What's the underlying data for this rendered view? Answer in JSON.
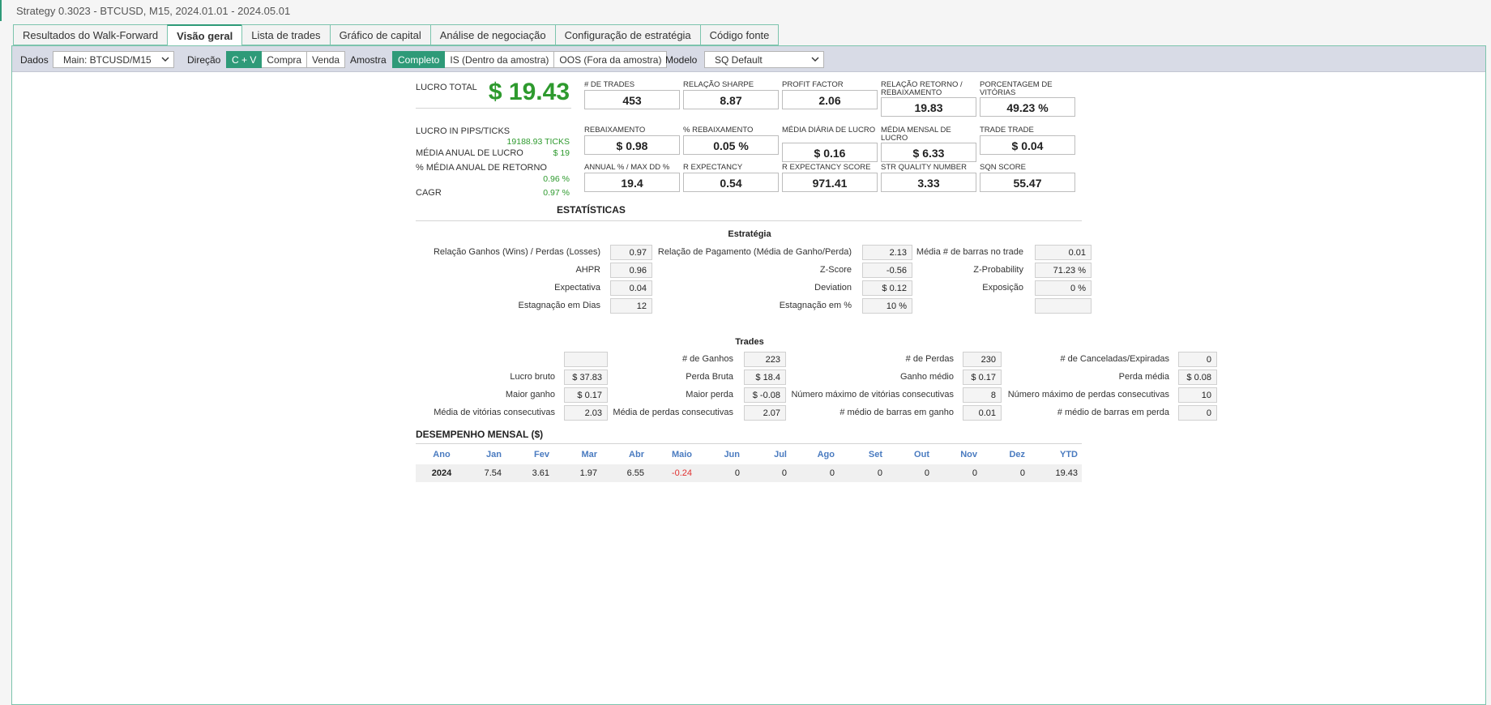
{
  "window": {
    "title": "Strategy 0.3023 - BTCUSD, M15, 2024.01.01 - 2024.05.01"
  },
  "tabs": [
    {
      "label": "Resultados do Walk-Forward"
    },
    {
      "label": "Visão geral"
    },
    {
      "label": "Lista de trades"
    },
    {
      "label": "Gráfico de capital"
    },
    {
      "label": "Análise de negociação"
    },
    {
      "label": "Configuração de estratégia"
    },
    {
      "label": "Código fonte"
    }
  ],
  "toolbar": {
    "dados_label": "Dados",
    "dados_value": "Main: BTCUSD/M15",
    "direcao_label": "Direção",
    "direcao_options": [
      "C + V",
      "Compra",
      "Venda"
    ],
    "amostra_label": "Amostra",
    "amostra_options": [
      "Completo",
      "IS (Dentro da amostra)",
      "OOS (Fora da amostra)"
    ],
    "modelo_label": "Modelo",
    "modelo_value": "SQ Default"
  },
  "summary": {
    "lucro_total_label": "LUCRO TOTAL",
    "lucro_total_value": "$ 19.43",
    "pips_label": "LUCRO IN PIPS/TICKS",
    "pips_value": "19188.93 TICKS",
    "media_anual_label": "MÉDIA ANUAL DE LUCRO",
    "media_anual_value": "$ 19",
    "pct_media_label": "% MÉDIA ANUAL DE RETORNO",
    "pct_media_value": "0.96 %",
    "cagr_label": "CAGR",
    "cagr_value": "0.97 %"
  },
  "metrics": [
    {
      "label": "# DE TRADES",
      "value": "453"
    },
    {
      "label": "RELAÇÃO SHARPE",
      "value": "8.87"
    },
    {
      "label": "PROFIT FACTOR",
      "value": "2.06"
    },
    {
      "label": "RELAÇÃO RETORNO / REBAIXAMENTO",
      "value": "19.83"
    },
    {
      "label": "PORCENTAGEM DE VITÓRIAS",
      "value": "49.23 %"
    },
    {
      "label": "REBAIXAMENTO",
      "value": "$ 0.98"
    },
    {
      "label": "% REBAIXAMENTO",
      "value": "0.05 %"
    },
    {
      "label": "MÉDIA DIÁRIA DE LUCRO",
      "value": "$ 0.16"
    },
    {
      "label": "MÉDIA MENSAL DE LUCRO",
      "value": "$ 6.33"
    },
    {
      "label": "TRADE TRADE",
      "value": "$ 0.04"
    },
    {
      "label": "ANNUAL % / MAX DD %",
      "value": "19.4"
    },
    {
      "label": "R EXPECTANCY",
      "value": "0.54"
    },
    {
      "label": "R EXPECTANCY SCORE",
      "value": "971.41"
    },
    {
      "label": "STR QUALITY NUMBER",
      "value": "3.33"
    },
    {
      "label": "SQN SCORE",
      "value": "55.47"
    }
  ],
  "estatisticas": {
    "title": "ESTATÍSTICAS",
    "estrategia_title": "Estratégia",
    "col1": [
      {
        "label": "Relação Ganhos (Wins) / Perdas (Losses)",
        "value": "0.97"
      },
      {
        "label": "AHPR",
        "value": "0.96"
      },
      {
        "label": "Expectativa",
        "value": "0.04"
      },
      {
        "label": "Estagnação em Dias",
        "value": "12"
      }
    ],
    "col2": [
      {
        "label": "Relação de Pagamento (Média de Ganho/Perda)",
        "value": "2.13"
      },
      {
        "label": "Z-Score",
        "value": "-0.56"
      },
      {
        "label": "Deviation",
        "value": "$ 0.12"
      },
      {
        "label": "Estagnação em %",
        "value": "10 %"
      }
    ],
    "col3": [
      {
        "label": "Média # de barras no trade",
        "value": "0.01"
      },
      {
        "label": "Z-Probability",
        "value": "71.23 %"
      },
      {
        "label": "Exposição",
        "value": "0 %"
      },
      {
        "label": "",
        "value": ""
      }
    ]
  },
  "trades": {
    "title": "Trades",
    "col1": [
      {
        "label": "",
        "value": ""
      },
      {
        "label": "Lucro bruto",
        "value": "$ 37.83"
      },
      {
        "label": "Maior ganho",
        "value": "$ 0.17"
      },
      {
        "label": "Média de vitórias consecutivas",
        "value": "2.03"
      }
    ],
    "col2": [
      {
        "label": "# de Ganhos",
        "value": "223"
      },
      {
        "label": "Perda Bruta",
        "value": "$ 18.4"
      },
      {
        "label": "Maior perda",
        "value": "$ -0.08"
      },
      {
        "label": "Média de perdas consecutivas",
        "value": "2.07"
      }
    ],
    "col3": [
      {
        "label": "# de Perdas",
        "value": "230"
      },
      {
        "label": "Ganho médio",
        "value": "$ 0.17"
      },
      {
        "label": "Número máximo de vitórias consecutivas",
        "value": "8"
      },
      {
        "label": "# médio de barras em ganho",
        "value": "0.01"
      }
    ],
    "col4": [
      {
        "label": "# de Canceladas/Expiradas",
        "value": "0"
      },
      {
        "label": "Perda média",
        "value": "$ 0.08"
      },
      {
        "label": "Número máximo de perdas consecutivas",
        "value": "10"
      },
      {
        "label": "# médio de barras em perda",
        "value": "0"
      }
    ]
  },
  "mensal": {
    "title": "DESEMPENHO MENSAL ($)",
    "headers": [
      "Ano",
      "Jan",
      "Fev",
      "Mar",
      "Abr",
      "Maio",
      "Jun",
      "Jul",
      "Ago",
      "Set",
      "Out",
      "Nov",
      "Dez",
      "YTD"
    ],
    "row": [
      "2024",
      "7.54",
      "3.61",
      "1.97",
      "6.55",
      "-0.24",
      "0",
      "0",
      "0",
      "0",
      "0",
      "0",
      "0",
      "19.43"
    ],
    "negative_color": "#e03030"
  },
  "colors": {
    "accent": "#2e9a78",
    "profit": "#2e9a2e",
    "month_header": "#4a7bc0"
  }
}
